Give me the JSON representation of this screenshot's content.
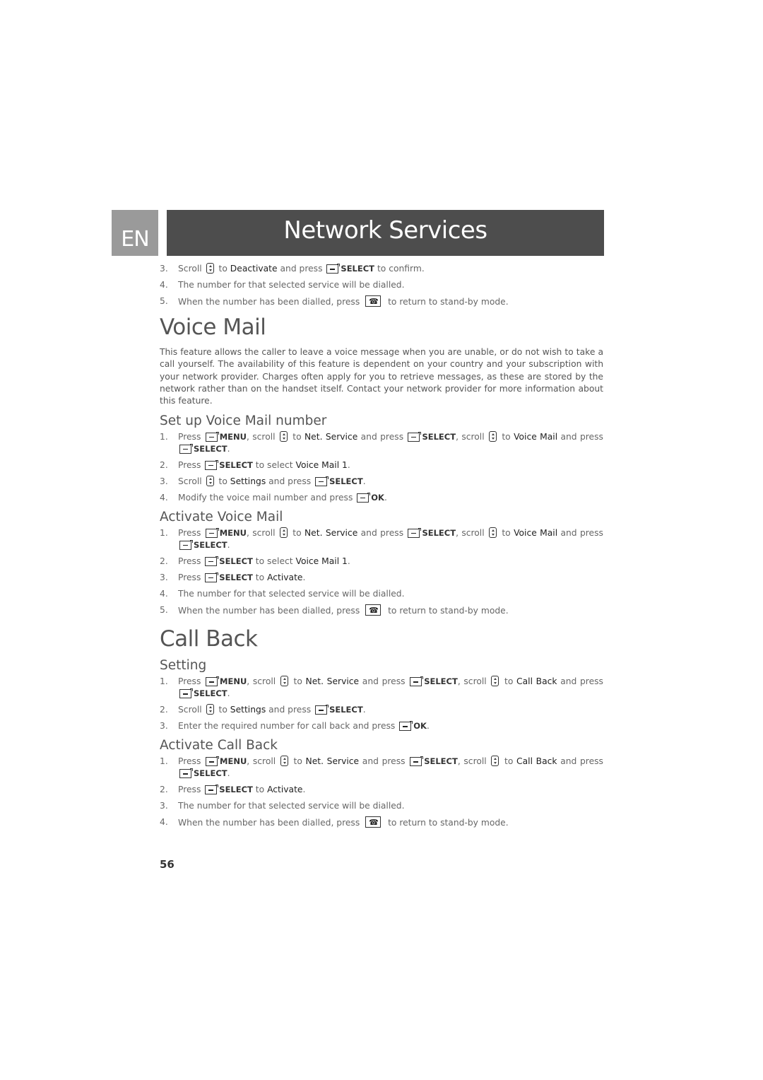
{
  "header": {
    "language_badge": "EN",
    "title": "Network Services"
  },
  "intro_steps": [
    {
      "num": "3.",
      "parts": [
        {
          "t": "Scroll "
        },
        {
          "icon": "scroll"
        },
        {
          "t": " to "
        },
        {
          "k": "Deactivate"
        },
        {
          "t": " and press "
        },
        {
          "icon": "soft"
        },
        {
          "b": "SELECT"
        },
        {
          "t": " to confirm."
        }
      ]
    },
    {
      "num": "4.",
      "parts": [
        {
          "t": "The number for that selected service will be dialled."
        }
      ]
    },
    {
      "num": "5.",
      "parts": [
        {
          "t": "When the number has been dialled, press "
        },
        {
          "icon": "end"
        },
        {
          "t": " to return to stand-by mode."
        }
      ]
    }
  ],
  "voice_mail": {
    "title": "Voice Mail",
    "description": "This feature allows the caller to leave a voice message when you are unable, or do not wish to take a call yourself. The availability of this feature is dependent on your country and your subscription with your network provider. Charges often apply for you to retrieve messages, as these are stored by the network rather than on the handset itself. Contact your network provider for more information about this feature.",
    "setup": {
      "title": "Set up Voice Mail number",
      "steps": [
        {
          "num": "1.",
          "parts": [
            {
              "t": "Press "
            },
            {
              "icon": "soft"
            },
            {
              "b": "MENU"
            },
            {
              "t": ", scroll "
            },
            {
              "icon": "scroll"
            },
            {
              "t": " to "
            },
            {
              "k": "Net. Service"
            },
            {
              "t": " and press "
            },
            {
              "icon": "soft"
            },
            {
              "b": "SELECT"
            },
            {
              "t": ", scroll "
            },
            {
              "icon": "scroll"
            },
            {
              "t": " to "
            },
            {
              "k": "Voice Mail"
            },
            {
              "t": " and press "
            },
            {
              "icon": "soft"
            },
            {
              "b": "SELECT"
            },
            {
              "t": "."
            }
          ]
        },
        {
          "num": "2.",
          "parts": [
            {
              "t": "Press "
            },
            {
              "icon": "soft"
            },
            {
              "b": "SELECT"
            },
            {
              "t": " to select "
            },
            {
              "k": "Voice Mail 1"
            },
            {
              "t": "."
            }
          ]
        },
        {
          "num": "3.",
          "parts": [
            {
              "t": "Scroll "
            },
            {
              "icon": "scroll"
            },
            {
              "t": " to "
            },
            {
              "k": "Settings"
            },
            {
              "t": " and press "
            },
            {
              "icon": "soft"
            },
            {
              "b": "SELECT"
            },
            {
              "t": "."
            }
          ]
        },
        {
          "num": "4.",
          "parts": [
            {
              "t": "Modify the voice mail number and press "
            },
            {
              "icon": "soft"
            },
            {
              "b": "OK"
            },
            {
              "t": "."
            }
          ]
        }
      ]
    },
    "activate": {
      "title": "Activate Voice Mail",
      "steps": [
        {
          "num": "1.",
          "parts": [
            {
              "t": "Press "
            },
            {
              "icon": "soft"
            },
            {
              "b": "MENU"
            },
            {
              "t": ", scroll "
            },
            {
              "icon": "scroll"
            },
            {
              "t": " to "
            },
            {
              "k": "Net. Service"
            },
            {
              "t": " and press "
            },
            {
              "icon": "soft"
            },
            {
              "b": "SELECT"
            },
            {
              "t": ", scroll "
            },
            {
              "icon": "scroll"
            },
            {
              "t": " to "
            },
            {
              "k": "Voice Mail"
            },
            {
              "t": " and press "
            },
            {
              "icon": "soft"
            },
            {
              "b": "SELECT"
            },
            {
              "t": "."
            }
          ]
        },
        {
          "num": "2.",
          "parts": [
            {
              "t": "Press "
            },
            {
              "icon": "soft"
            },
            {
              "b": "SELECT"
            },
            {
              "t": " to select "
            },
            {
              "k": "Voice Mail 1"
            },
            {
              "t": "."
            }
          ]
        },
        {
          "num": "3.",
          "parts": [
            {
              "t": "Press "
            },
            {
              "icon": "soft"
            },
            {
              "b": "SELECT"
            },
            {
              "t": " to "
            },
            {
              "k": "Activate"
            },
            {
              "t": "."
            }
          ]
        },
        {
          "num": "4.",
          "parts": [
            {
              "t": "The number for that selected service will be dialled."
            }
          ]
        },
        {
          "num": "5.",
          "parts": [
            {
              "t": "When the number has been dialled, press "
            },
            {
              "icon": "end"
            },
            {
              "t": " to return to stand-by mode."
            }
          ]
        }
      ]
    }
  },
  "call_back": {
    "title": "Call Back",
    "setting": {
      "title": "Setting",
      "steps": [
        {
          "num": "1.",
          "parts": [
            {
              "t": "Press "
            },
            {
              "icon": "soft"
            },
            {
              "b": "MENU"
            },
            {
              "t": ", scroll "
            },
            {
              "icon": "scroll"
            },
            {
              "t": " to "
            },
            {
              "k": "Net. Service"
            },
            {
              "t": " and press "
            },
            {
              "icon": "soft"
            },
            {
              "b": "SELECT"
            },
            {
              "t": ", scroll "
            },
            {
              "icon": "scroll"
            },
            {
              "t": " to "
            },
            {
              "k": "Call Back"
            },
            {
              "t": " and press "
            },
            {
              "icon": "soft"
            },
            {
              "b": "SELECT"
            },
            {
              "t": "."
            }
          ]
        },
        {
          "num": "2.",
          "parts": [
            {
              "t": "Scroll "
            },
            {
              "icon": "scroll"
            },
            {
              "t": " to "
            },
            {
              "k": "Settings"
            },
            {
              "t": " and press "
            },
            {
              "icon": "soft"
            },
            {
              "b": "SELECT"
            },
            {
              "t": "."
            }
          ]
        },
        {
          "num": "3.",
          "parts": [
            {
              "t": "Enter the required number for call back and press "
            },
            {
              "icon": "soft"
            },
            {
              "b": "OK"
            },
            {
              "t": "."
            }
          ]
        }
      ]
    },
    "activate": {
      "title": "Activate Call Back",
      "steps": [
        {
          "num": "1.",
          "parts": [
            {
              "t": "Press "
            },
            {
              "icon": "soft"
            },
            {
              "b": "MENU"
            },
            {
              "t": ", scroll "
            },
            {
              "icon": "scroll"
            },
            {
              "t": " to "
            },
            {
              "k": "Net. Service"
            },
            {
              "t": " and press "
            },
            {
              "icon": "soft"
            },
            {
              "b": "SELECT"
            },
            {
              "t": ", scroll "
            },
            {
              "icon": "scroll"
            },
            {
              "t": " to "
            },
            {
              "k": "Call Back"
            },
            {
              "t": " and press "
            },
            {
              "icon": "soft"
            },
            {
              "b": "SELECT"
            },
            {
              "t": "."
            }
          ]
        },
        {
          "num": "2.",
          "parts": [
            {
              "t": "Press "
            },
            {
              "icon": "soft"
            },
            {
              "b": "SELECT"
            },
            {
              "t": " to "
            },
            {
              "k": "Activate"
            },
            {
              "t": "."
            }
          ]
        },
        {
          "num": "3.",
          "parts": [
            {
              "t": "The number for that selected service will be dialled."
            }
          ]
        },
        {
          "num": "4.",
          "parts": [
            {
              "t": "When the number has been dialled, press "
            },
            {
              "icon": "end"
            },
            {
              "t": " to return to stand-by mode."
            }
          ]
        }
      ]
    }
  },
  "icons": {
    "soft": "soft-key-icon",
    "scroll": "scroll-key-icon",
    "end": "end-call-key-icon"
  },
  "footer": {
    "page_number": "56"
  }
}
